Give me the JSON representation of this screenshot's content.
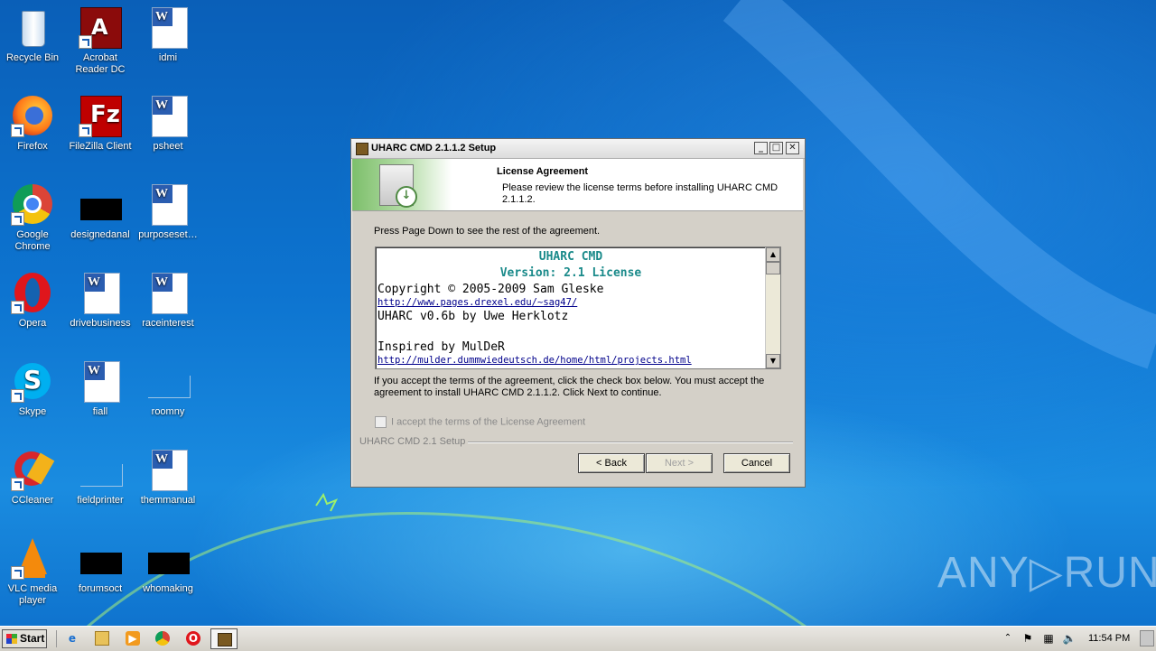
{
  "desktop": {
    "icons": [
      {
        "label": "Recycle Bin",
        "icon": "recycle-bin-icon"
      },
      {
        "label": "Acrobat Reader DC",
        "icon": "acrobat-icon"
      },
      {
        "label": "idmi",
        "icon": "word-doc-icon"
      },
      {
        "label": "Firefox",
        "icon": "firefox-icon"
      },
      {
        "label": "FileZilla Client",
        "icon": "filezilla-icon"
      },
      {
        "label": "psheet",
        "icon": "word-doc-icon"
      },
      {
        "label": "Google Chrome",
        "icon": "chrome-icon"
      },
      {
        "label": "designedanal",
        "icon": "black-thumbnail-icon"
      },
      {
        "label": "purposeset…",
        "icon": "word-doc-icon"
      },
      {
        "label": "Opera",
        "icon": "opera-icon"
      },
      {
        "label": "drivebusiness",
        "icon": "word-doc-icon"
      },
      {
        "label": "raceinterest",
        "icon": "word-doc-icon"
      },
      {
        "label": "Skype",
        "icon": "skype-icon"
      },
      {
        "label": "fiall",
        "icon": "word-doc-icon"
      },
      {
        "label": "roomny",
        "icon": "blank-file-icon"
      },
      {
        "label": "CCleaner",
        "icon": "ccleaner-icon"
      },
      {
        "label": "fieldprinter",
        "icon": "blank-file-icon"
      },
      {
        "label": "themmanual",
        "icon": "word-doc-icon"
      },
      {
        "label": "VLC media player",
        "icon": "vlc-icon"
      },
      {
        "label": "forumsoct",
        "icon": "black-thumbnail-icon"
      },
      {
        "label": "whomaking",
        "icon": "black-thumbnail-icon"
      }
    ],
    "watermark": "ANY▷RUN"
  },
  "dialog": {
    "title": "UHARC CMD 2.1.1.2 Setup",
    "header_title": "License Agreement",
    "header_subtitle": "Please review the license terms before installing UHARC CMD 2.1.1.2.",
    "instruction": "Press Page Down to see the rest of the agreement.",
    "license": {
      "line1": "UHARC CMD",
      "line2": "Version: 2.1 License",
      "line3": "Copyright © 2005-2009 Sam Gleske",
      "line4": "http://www.pages.drexel.edu/~sag47/",
      "line5": "UHARC v0.6b by Uwe Herklotz",
      "line6": "Inspired by MulDeR",
      "line7": "http://mulder.dummwiedeutsch.de/home/html/projects.html"
    },
    "notice": "If you accept the terms of the agreement, click the check box below. You must accept the agreement to install UHARC CMD 2.1.1.2. Click Next to continue.",
    "checkbox_label": "I accept the terms of the License Agreement",
    "checkbox_checked": false,
    "branding": "UHARC CMD 2.1 Setup",
    "buttons": {
      "back": "< Back",
      "next": "Next >",
      "cancel": "Cancel"
    },
    "window_controls": {
      "minimize": "_",
      "maximize": "□",
      "close": "✕"
    }
  },
  "taskbar": {
    "start_label": "Start",
    "clock": "11:54 PM",
    "quicklaunch": [
      "ie-icon",
      "explorer-icon",
      "media-player-icon",
      "chrome-icon",
      "opera-icon"
    ],
    "tray": [
      "show-hidden-icon",
      "flag-icon",
      "network-icon",
      "volume-icon"
    ]
  }
}
